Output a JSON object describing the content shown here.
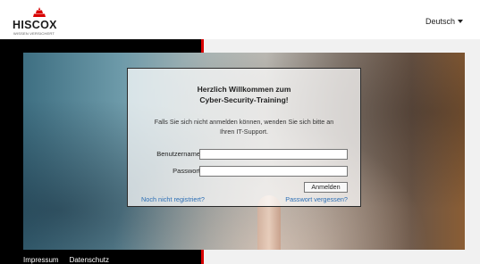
{
  "header": {
    "logo_text": "HISCOX",
    "logo_tagline": "WISSEN VERSICHERT",
    "language": "Deutsch",
    "language_icon": "caret-down-icon"
  },
  "login": {
    "title_line1": "Herzlich Willkommen zum",
    "title_line2": "Cyber-Security-Training!",
    "message_line1": "Falls Sie sich nicht anmelden können, wenden Sie sich bitte an",
    "message_line2": "Ihren IT-Support.",
    "username_label": "Benutzername",
    "username_value": "",
    "password_label": "Passwort",
    "password_value": "",
    "submit_label": "Anmelden",
    "register_link": "Noch nicht registriert?",
    "forgot_link": "Passwort vergessen?"
  },
  "footer": {
    "impressum": "Impressum",
    "datenschutz": "Datenschutz"
  },
  "colors": {
    "accent_red": "#d80000",
    "link_blue": "#2d6fb5"
  }
}
